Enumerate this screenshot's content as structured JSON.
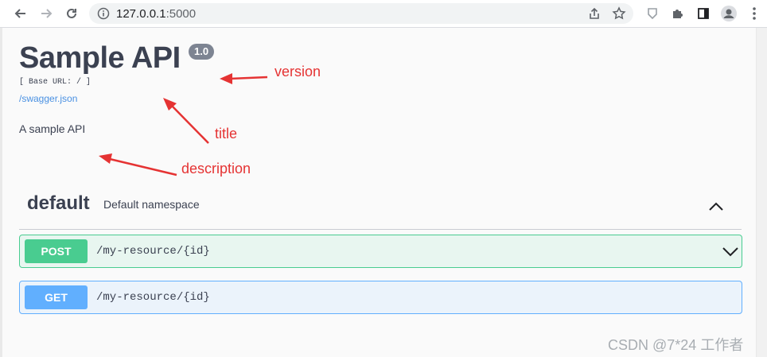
{
  "browser": {
    "url_host": "127.0.0.1",
    "url_port": ":5000"
  },
  "api": {
    "title": "Sample API",
    "version": "1.0",
    "base_url": "[ Base URL: / ]",
    "spec_link": "/swagger.json",
    "description": "A sample API"
  },
  "annotations": {
    "version_label": "version",
    "title_label": "title",
    "description_label": "description"
  },
  "namespace": {
    "name": "default",
    "description": "Default namespace"
  },
  "operations": [
    {
      "method": "POST",
      "path": "/my-resource/{id}"
    },
    {
      "method": "GET",
      "path": "/my-resource/{id}"
    }
  ],
  "watermark": "CSDN @7*24 工作者",
  "colors": {
    "post": "#49cc90",
    "get": "#61affe",
    "annotation": "#e53333",
    "text": "#3b4151"
  }
}
